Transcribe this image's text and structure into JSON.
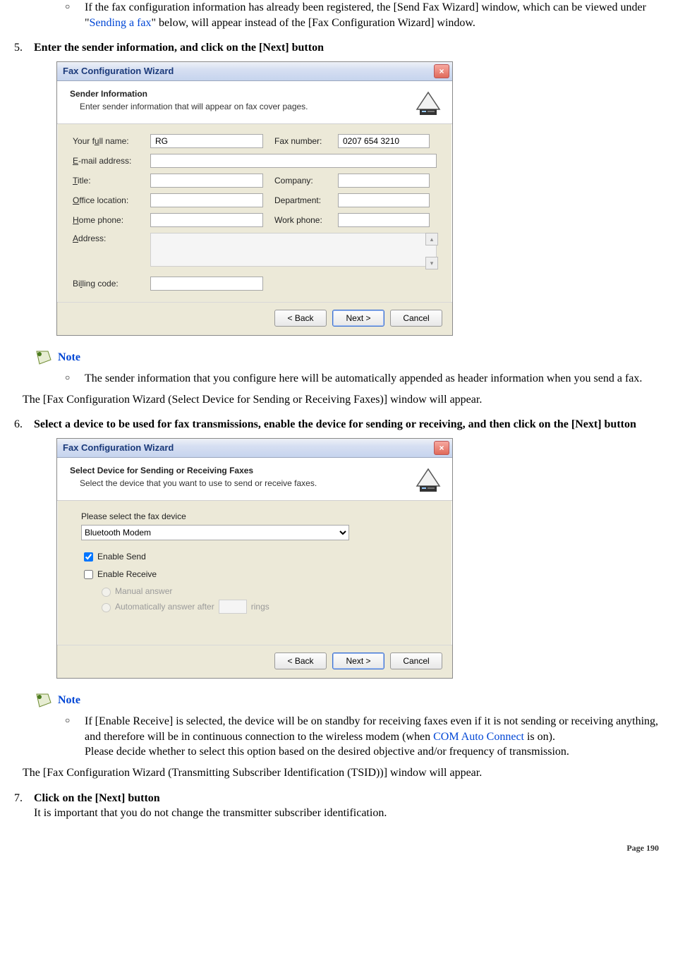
{
  "bullet_top": {
    "pre": "If the fax configuration information has already been registered, the [Send Fax Wizard] window, which can be viewed under \"",
    "link": "Sending a fax",
    "post": "\" below, will appear instead of the [Fax Configuration Wizard] window."
  },
  "step5": {
    "num": "5.",
    "text": "Enter the sender information, and click on the [Next] button"
  },
  "dlg1": {
    "title": "Fax Configuration Wizard",
    "h1": "Sender Information",
    "h2": "Enter sender information that will appear on fax cover pages.",
    "labels": {
      "fullname": "Your full name:",
      "fax": "Fax number:",
      "email": "E-mail address:",
      "titlef": "Title:",
      "company": "Company:",
      "office": "Office location:",
      "dept": "Department:",
      "homeph": "Home phone:",
      "workph": "Work phone:",
      "address": "Address:",
      "billing": "Billing code:"
    },
    "values": {
      "fullname": "RG",
      "fax": "0207 654 3210",
      "email": ""
    },
    "buttons": {
      "back": "< Back",
      "next": "Next >",
      "cancel": "Cancel"
    }
  },
  "note1": {
    "label": "Note",
    "text": "The sender information that you configure here will be automatically appended as header information when you send a fax."
  },
  "para1": "The [Fax Configuration Wizard (Select Device for Sending or Receiving Faxes)] window will appear.",
  "step6": {
    "num": "6.",
    "text": "Select a device to be used for fax transmissions, enable the device for sending or receiving, and then click on the [Next] button"
  },
  "dlg2": {
    "title": "Fax Configuration Wizard",
    "h1": "Select Device for Sending or Receiving Faxes",
    "h2": "Select the device that you want to use to send or receive faxes.",
    "selectLabel": "Please select the fax device",
    "selectValue": "Bluetooth Modem",
    "enableSend": "Enable Send",
    "enableReceive": "Enable Receive",
    "manual": "Manual answer",
    "auto": "Automatically answer after",
    "rings": "rings",
    "buttons": {
      "back": "< Back",
      "next": "Next >",
      "cancel": "Cancel"
    }
  },
  "note2": {
    "label": "Note",
    "line1a": "If [Enable Receive] is selected, the device will be on standby for receiving faxes even if it is not sending or receiving anything, and therefore will be in continuous connection to the wireless modem (when ",
    "link": "COM Auto Connect",
    "line1b": " is on).",
    "line2": "Please decide whether to select this option based on the desired objective and/or frequency of transmission."
  },
  "para2": "The [Fax Configuration Wizard (Transmitting Subscriber Identification (TSID))] window will appear.",
  "step7": {
    "num": "7.",
    "title": "Click on the [Next] button",
    "sub": "It is important that you do not change the transmitter subscriber identification."
  },
  "footer": {
    "label": "Page ",
    "num": "190"
  }
}
